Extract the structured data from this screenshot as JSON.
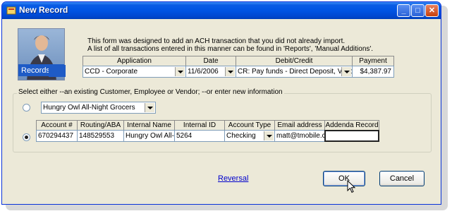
{
  "window": {
    "title": "New Record",
    "controls": {
      "minimize": "_",
      "maximize": "□",
      "close": "✕"
    }
  },
  "logo": {
    "label": "Records"
  },
  "info": {
    "line1": "This form was designed to add an ACH transaction that you did not already import.",
    "line2": "A list of all transactions entered in this manner can be found in 'Reports', 'Manual Additions'."
  },
  "transaction": {
    "headers": {
      "application": "Application",
      "date": "Date",
      "debit_credit": "Debit/Credit",
      "payment": "Payment"
    },
    "values": {
      "application": "CCD - Corporate",
      "date": "11/6/2006",
      "debit_credit": "CR: Pay funds - Direct Deposit, Venc",
      "payment": "$4,387.97"
    }
  },
  "selection": {
    "group_label": "Select either --an existing Customer, Employee or Vendor;  --or enter new information",
    "existing_value": "Hungry Owl All-Night Grocers",
    "new_info": {
      "headers": {
        "account": "Account #",
        "routing": "Routing/ABA #",
        "internal_name": "Internal Name",
        "internal_id": "Internal ID",
        "account_type": "Account Type",
        "email": "Email address",
        "addenda": "Addenda Record"
      },
      "values": {
        "account": "670294437",
        "routing": "148529553",
        "internal_name": "Hungry Owl All-N",
        "internal_id": "5264",
        "account_type": "Checking",
        "email": "matt@tmobile.coi",
        "addenda": ""
      }
    }
  },
  "footer": {
    "reversal_link": "Reversal",
    "ok_label": "OK",
    "cancel_label": "Cancel"
  }
}
